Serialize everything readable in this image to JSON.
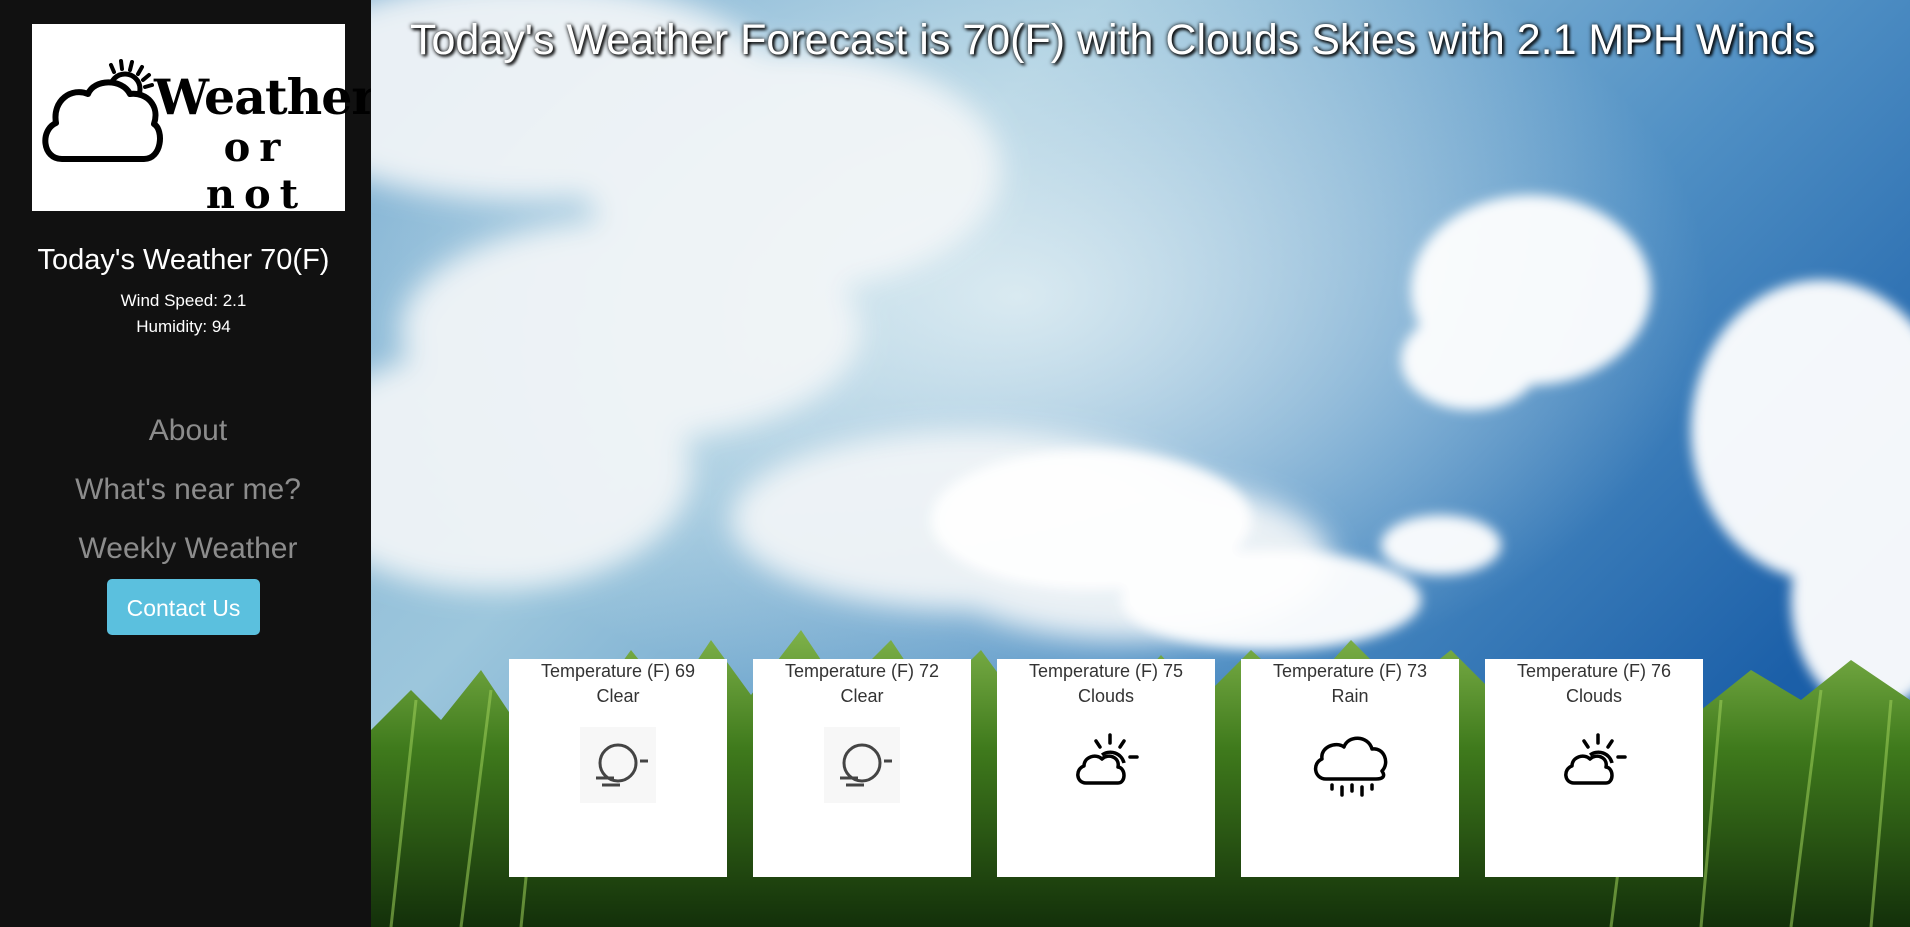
{
  "logo": {
    "line1": "Weather",
    "line2": "or not",
    "icon": "cloud-sun-icon"
  },
  "current": {
    "summary": "Today's Weather 70(F)",
    "wind": "Wind Speed: 2.1",
    "humidity": "Humidity: 94"
  },
  "nav": {
    "about": "About",
    "near": "What's near me?",
    "weekly": "Weekly Weather",
    "contact": "Contact Us"
  },
  "headline": "Today's Weather Forecast is 70(F) with Clouds Skies with 2.1 MPH Winds",
  "forecast": [
    {
      "temp": "Temperature (F) 69",
      "condition": "Clear",
      "icon": "clear-night-icon"
    },
    {
      "temp": "Temperature (F) 72",
      "condition": "Clear",
      "icon": "clear-night-icon"
    },
    {
      "temp": "Temperature (F) 75",
      "condition": "Clouds",
      "icon": "partly-cloudy-icon"
    },
    {
      "temp": "Temperature (F) 73",
      "condition": "Rain",
      "icon": "rain-cloud-icon"
    },
    {
      "temp": "Temperature (F) 76",
      "condition": "Clouds",
      "icon": "partly-cloudy-icon"
    }
  ],
  "colors": {
    "sidebar": "#111111",
    "contact_button": "#5bc0de",
    "nav_link": "#8c8c8c",
    "sky_top": "#1b5fa8",
    "grass": "#3f7a1c"
  }
}
